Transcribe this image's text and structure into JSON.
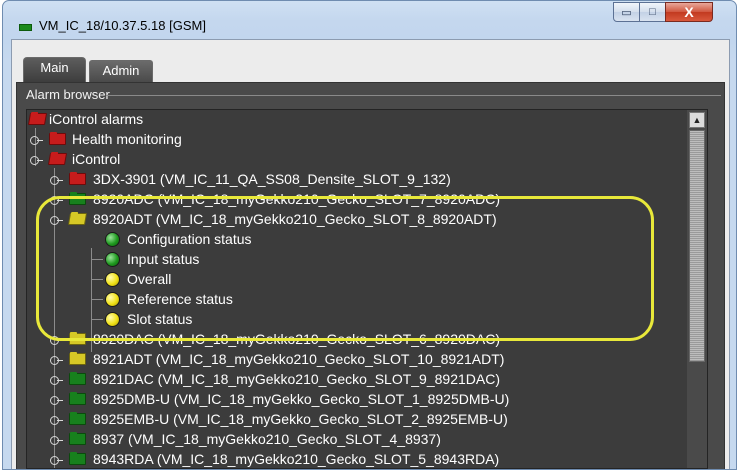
{
  "window": {
    "title": "VM_IC_18/10.37.5.18 [GSM]",
    "min_glyph": "▭",
    "max_glyph": "□",
    "close_glyph": "X"
  },
  "tabs": [
    {
      "label": "Main",
      "active": true
    },
    {
      "label": "Admin",
      "active": false
    }
  ],
  "group": {
    "label": "Alarm browser"
  },
  "tree": {
    "root": {
      "label": "iControl alarms",
      "icon": "folder-open-icon"
    },
    "nodes": [
      {
        "label": "Health monitoring",
        "icon": "folder-red-icon"
      },
      {
        "label": "iControl",
        "icon": "folder-open-icon"
      },
      {
        "label": "3DX-3901 (VM_IC_11_QA_SS08_Densite_SLOT_9_132)",
        "icon": "folder-red-icon"
      },
      {
        "label": "8920ADC (VM_IC_18_myGekko210_Gecko_SLOT_7_8920ADC)",
        "icon": "folder-green-icon"
      },
      {
        "label": "8920ADT (VM_IC_18_myGekko210_Gecko_SLOT_8_8920ADT)",
        "icon": "folder-open-yellow-icon"
      },
      {
        "label": "Configuration status",
        "icon": "status-green-icon"
      },
      {
        "label": "Input status",
        "icon": "status-green-icon"
      },
      {
        "label": "Overall",
        "icon": "status-yellow-icon"
      },
      {
        "label": "Reference status",
        "icon": "status-yellow-icon"
      },
      {
        "label": "Slot status",
        "icon": "status-yellow-icon"
      },
      {
        "label": "8920DAC (VM_IC_18_myGekko210_Gecko_SLOT_6_8920DAC)",
        "icon": "folder-yellow-icon"
      },
      {
        "label": "8921ADT (VM_IC_18_myGekko210_Gecko_SLOT_10_8921ADT)",
        "icon": "folder-yellow-icon"
      },
      {
        "label": "8921DAC (VM_IC_18_myGekko210_Gecko_SLOT_9_8921DAC)",
        "icon": "folder-green-icon"
      },
      {
        "label": "8925DMB-U (VM_IC_18_myGekko_Gecko_SLOT_1_8925DMB-U)",
        "icon": "folder-green-icon"
      },
      {
        "label": "8925EMB-U (VM_IC_18_myGekko_Gecko_SLOT_2_8925EMB-U)",
        "icon": "folder-green-icon"
      },
      {
        "label": "8937 (VM_IC_18_myGekko210_Gecko_SLOT_4_8937)",
        "icon": "folder-green-icon"
      },
      {
        "label": "8943RDA (VM_IC_18_myGekko210_Gecko_SLOT_5_8943RDA)",
        "icon": "folder-green-icon"
      }
    ]
  },
  "colors": {
    "highlight": "#e8e83a",
    "status_green": "#1f9a1f",
    "status_yellow": "#f1e216",
    "folder_red": "#c71c1c"
  }
}
